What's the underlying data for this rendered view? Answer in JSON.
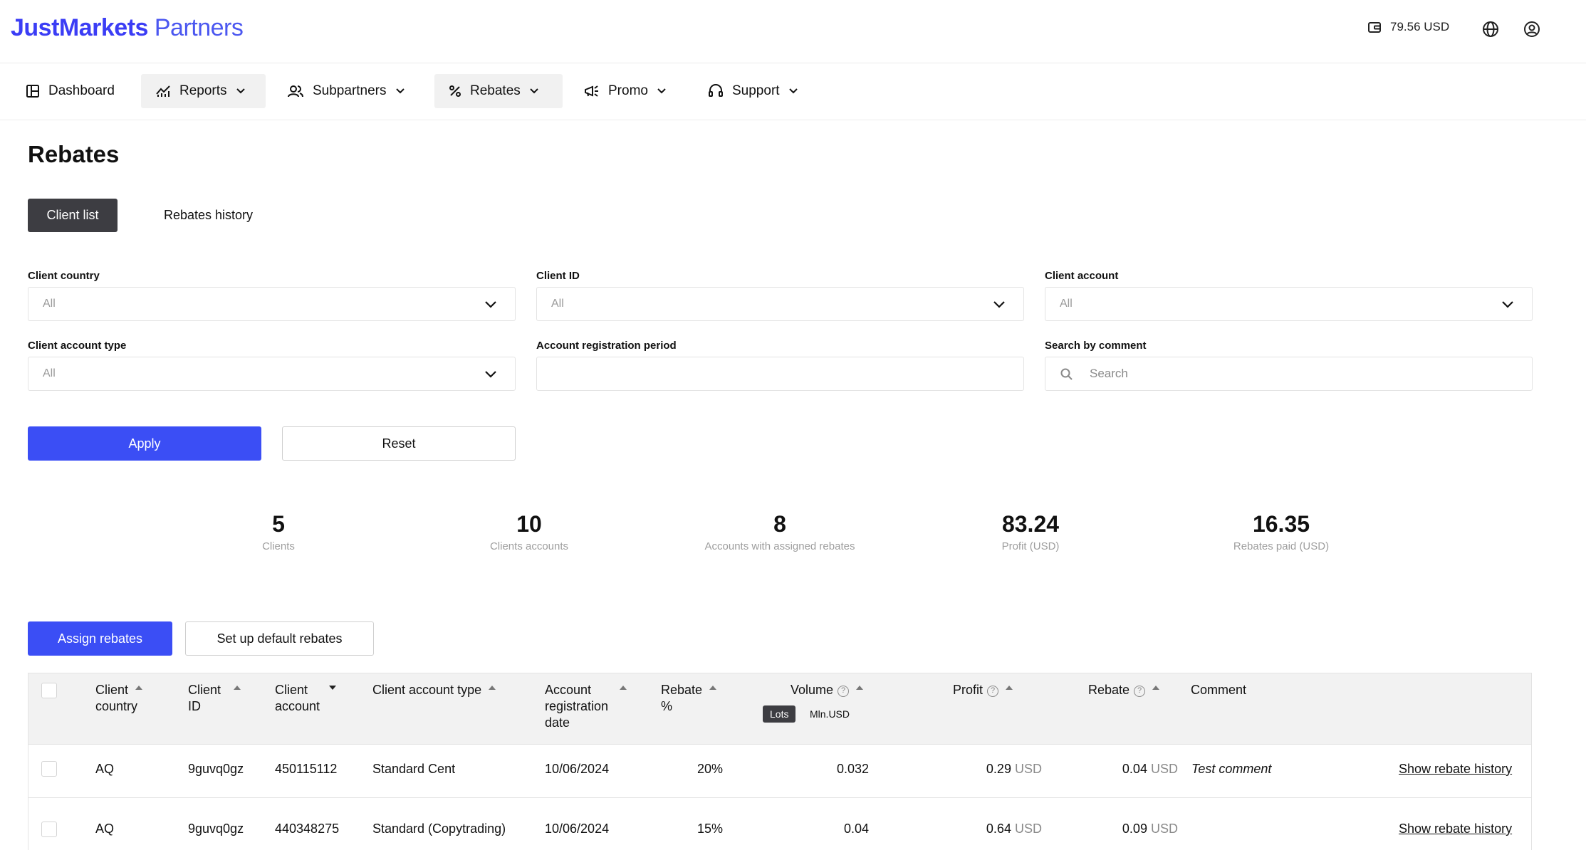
{
  "header": {
    "logo_bold": "JustMarkets",
    "logo_thin": "Partners",
    "balance": "79.56 USD"
  },
  "nav": {
    "items": [
      {
        "label": "Dashboard"
      },
      {
        "label": "Reports"
      },
      {
        "label": "Subpartners"
      },
      {
        "label": "Rebates"
      },
      {
        "label": "Promo"
      },
      {
        "label": "Support"
      }
    ]
  },
  "page": {
    "title": "Rebates",
    "tabs": [
      {
        "label": "Client list"
      },
      {
        "label": "Rebates history"
      }
    ]
  },
  "filters": {
    "client_country": {
      "label": "Client country",
      "value": "All"
    },
    "client_id": {
      "label": "Client ID",
      "value": "All"
    },
    "client_account": {
      "label": "Client account",
      "value": "All"
    },
    "client_account_type": {
      "label": "Client account type",
      "value": "All"
    },
    "registration_period": {
      "label": "Account registration period",
      "value": ""
    },
    "search_comment": {
      "label": "Search by comment",
      "placeholder": "Search"
    },
    "apply_label": "Apply",
    "reset_label": "Reset"
  },
  "stats": [
    {
      "value": "5",
      "label": "Clients"
    },
    {
      "value": "10",
      "label": "Clients accounts"
    },
    {
      "value": "8",
      "label": "Accounts with assigned rebates"
    },
    {
      "value": "83.24",
      "label": "Profit (USD)"
    },
    {
      "value": "16.35",
      "label": "Rebates paid (USD)"
    }
  ],
  "actions": {
    "assign_label": "Assign rebates",
    "default_label": "Set up default rebates"
  },
  "table": {
    "columns": {
      "country_1": "Client",
      "country_2": "country",
      "id_1": "Client",
      "id_2": "ID",
      "account_1": "Client",
      "account_2": "account",
      "type": "Client account type",
      "reg_1": "Account",
      "reg_2": "registration",
      "reg_3": "date",
      "rebate_pct_1": "Rebate",
      "rebate_pct_2": "%",
      "volume": "Volume",
      "volume_unit_on": "Lots",
      "volume_unit_off": "Mln.USD",
      "profit": "Profit",
      "rebate": "Rebate",
      "comment": "Comment"
    },
    "rows": [
      {
        "country": "AQ",
        "client_id": "9guvq0gz",
        "account": "450115112",
        "type": "Standard Cent",
        "reg_date": "10/06/2024",
        "rebate_pct": "20%",
        "volume": "0.032",
        "profit": "0.29",
        "rebate": "0.04",
        "currency": "USD",
        "comment": "Test comment",
        "history_link": "Show rebate history"
      },
      {
        "country": "AQ",
        "client_id": "9guvq0gz",
        "account": "440348275",
        "type": "Standard (Copytrading)",
        "reg_date": "10/06/2024",
        "rebate_pct": "15%",
        "volume": "0.04",
        "profit": "0.64",
        "rebate": "0.09",
        "currency": "USD",
        "comment": "",
        "history_link": "Show rebate history"
      }
    ]
  }
}
